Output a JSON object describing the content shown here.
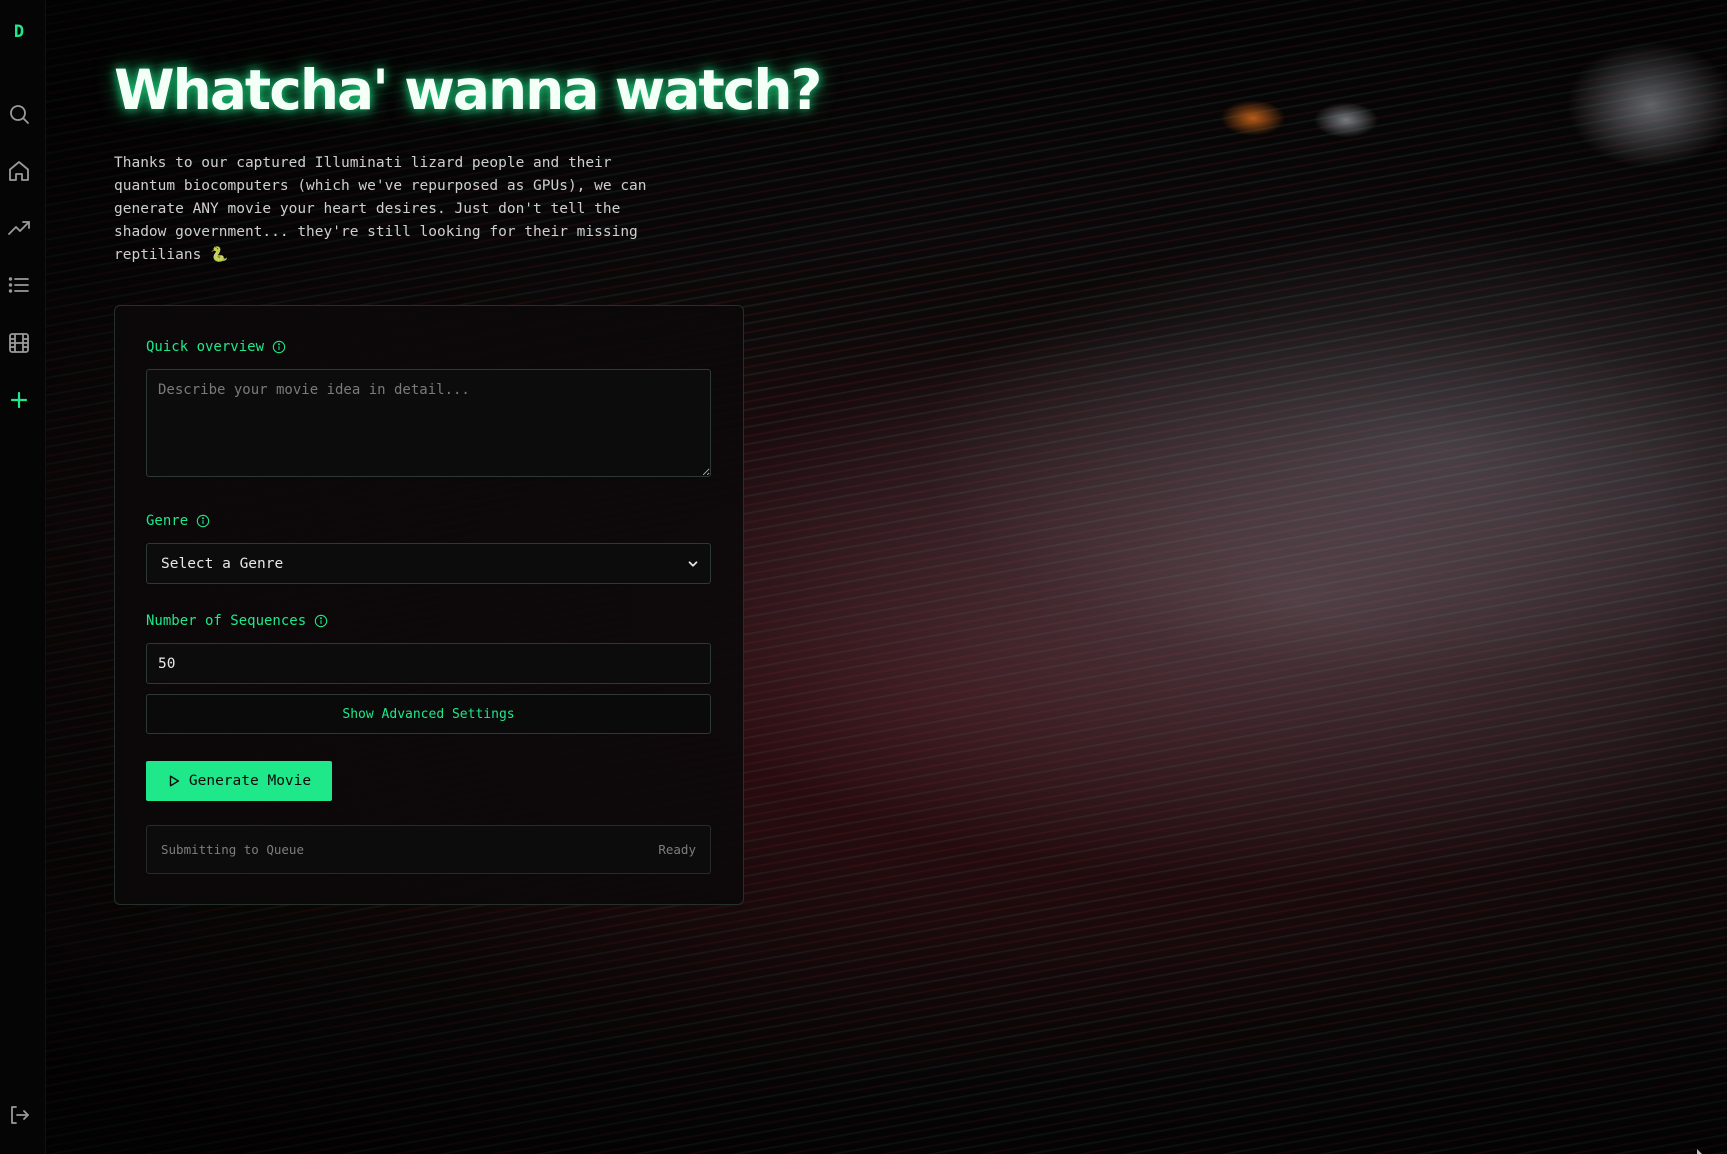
{
  "sidebar": {
    "logo": "D",
    "items": [
      {
        "icon": "search-icon"
      },
      {
        "icon": "home-icon"
      },
      {
        "icon": "trending-icon"
      },
      {
        "icon": "list-icon"
      },
      {
        "icon": "film-icon"
      },
      {
        "icon": "plus-icon"
      }
    ],
    "bottom_icon": "logout-icon"
  },
  "header": {
    "title": "Whatcha' wanna watch?",
    "intro": "Thanks to our captured Illuminati lizard people and their quantum biocomputers (which we've repurposed as GPUs), we can generate ANY movie your heart desires. Just don't tell the shadow government... they're still looking for their missing reptilians 🐍"
  },
  "form": {
    "overview": {
      "label": "Quick overview",
      "placeholder": "Describe your movie idea in detail...",
      "value": ""
    },
    "genre": {
      "label": "Genre",
      "selected": "Select a Genre"
    },
    "sequences": {
      "label": "Number of Sequences",
      "value": "50"
    },
    "advanced_label": "Show Advanced Settings",
    "generate_label": "Generate Movie",
    "status": {
      "text": "Submitting to Queue",
      "state": "Ready"
    }
  },
  "colors": {
    "accent": "#1ee88a",
    "background": "#070707",
    "card": "#0c090a"
  }
}
